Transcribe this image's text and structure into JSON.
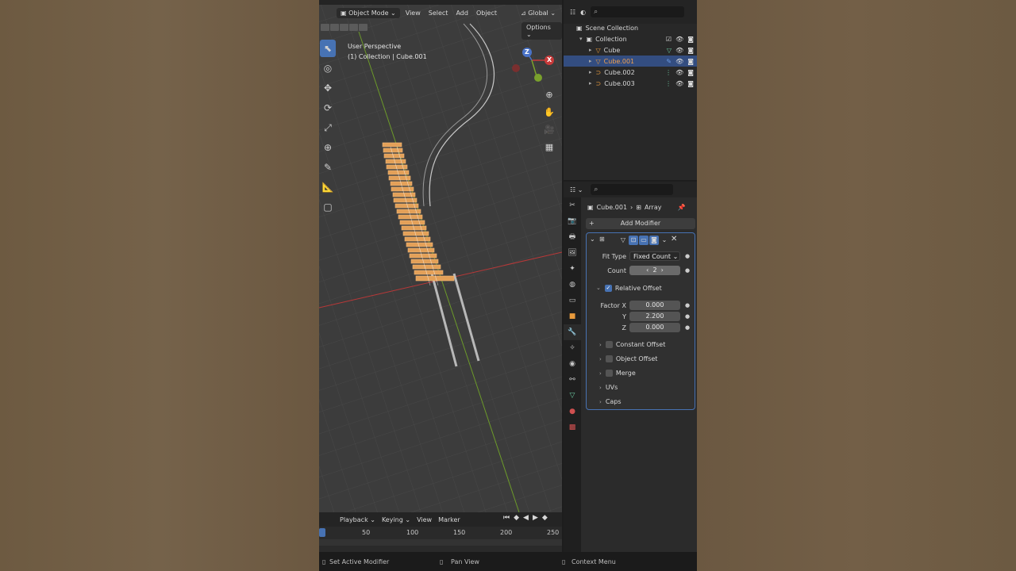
{
  "viewport": {
    "mode": "Object Mode",
    "menus": [
      "View",
      "Select",
      "Add",
      "Object"
    ],
    "orientation": "Global",
    "options_label": "Options",
    "info_line1": "User Perspective",
    "info_line2": "(1) Collection | Cube.001",
    "gizmo": {
      "z": "Z",
      "x": "X"
    }
  },
  "outliner": {
    "rows": [
      {
        "label": "Scene Collection"
      },
      {
        "label": "Collection"
      },
      {
        "label": "Cube"
      },
      {
        "label": "Cube.001"
      },
      {
        "label": "Cube.002"
      },
      {
        "label": "Cube.003"
      }
    ]
  },
  "properties": {
    "object_name": "Cube.001",
    "modifier_name": "Array",
    "add_modifier_label": "Add Modifier",
    "fit_type_label": "Fit Type",
    "fit_type_value": "Fixed Count",
    "count_label": "Count",
    "count_value": "2",
    "relative_offset_label": "Relative Offset",
    "factor_x_label": "Factor X",
    "factor_x_value": "0.000",
    "y_label": "Y",
    "y_value": "2.200",
    "z_label": "Z",
    "z_value": "0.000",
    "sections": [
      "Constant Offset",
      "Object Offset",
      "Merge",
      "UVs",
      "Caps"
    ]
  },
  "timeline": {
    "menus": [
      "Playback",
      "Keying",
      "View",
      "Marker"
    ],
    "ticks": [
      "50",
      "100",
      "150",
      "200",
      "250"
    ]
  },
  "statusbar": {
    "left": "Set Active Modifier",
    "middle": "Pan View",
    "right": "Context Menu"
  },
  "colors": {
    "accent": "#4772b3",
    "selection_orange": "#e89a3c",
    "x_axis": "#c83a3a",
    "y_axis": "#7aa12c"
  }
}
